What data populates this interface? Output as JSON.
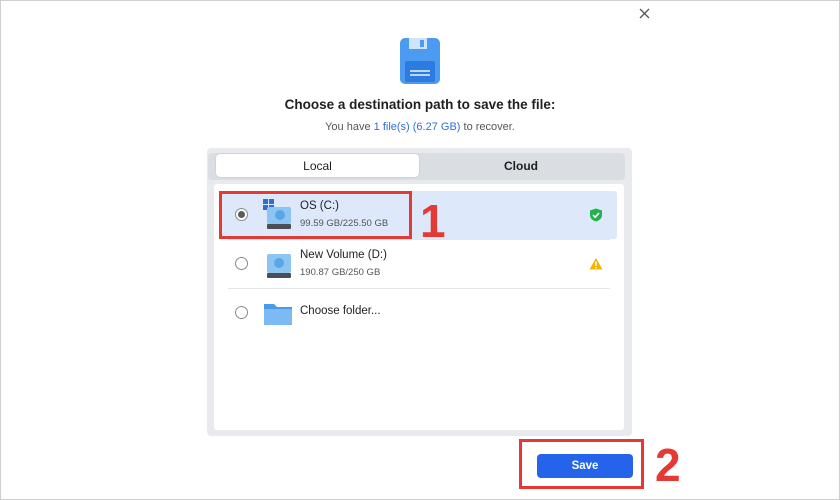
{
  "dialog": {
    "title": "Choose a destination path to save the file:",
    "subtitle_prefix": "You have ",
    "subtitle_count": "1 file(s)",
    "subtitle_size": " (6.27 GB)",
    "subtitle_suffix": " to recover.",
    "close_icon": "close-icon",
    "header_icon": "floppy-disk-icon"
  },
  "tabs": [
    {
      "label": "Local",
      "active": true
    },
    {
      "label": "Cloud",
      "active": false
    }
  ],
  "locations": [
    {
      "name": "OS (C:)",
      "size": "99.59 GB/225.50 GB",
      "selected": true,
      "icon": "system-drive-icon",
      "status": "shield-check-icon"
    },
    {
      "name": "New Volume (D:)",
      "size": "190.87 GB/250 GB",
      "selected": false,
      "icon": "drive-icon",
      "status": "warning-icon"
    },
    {
      "name": "Choose folder...",
      "size": "",
      "selected": false,
      "icon": "folder-icon",
      "status": ""
    }
  ],
  "actions": {
    "save_label": "Save"
  },
  "annotations": {
    "step1": "1",
    "step2": "2"
  },
  "colors": {
    "accent": "#2563eb",
    "annotation": "#e53935",
    "selected_row": "#dde8fb",
    "ok": "#22b14c",
    "warning": "#f5b400"
  }
}
